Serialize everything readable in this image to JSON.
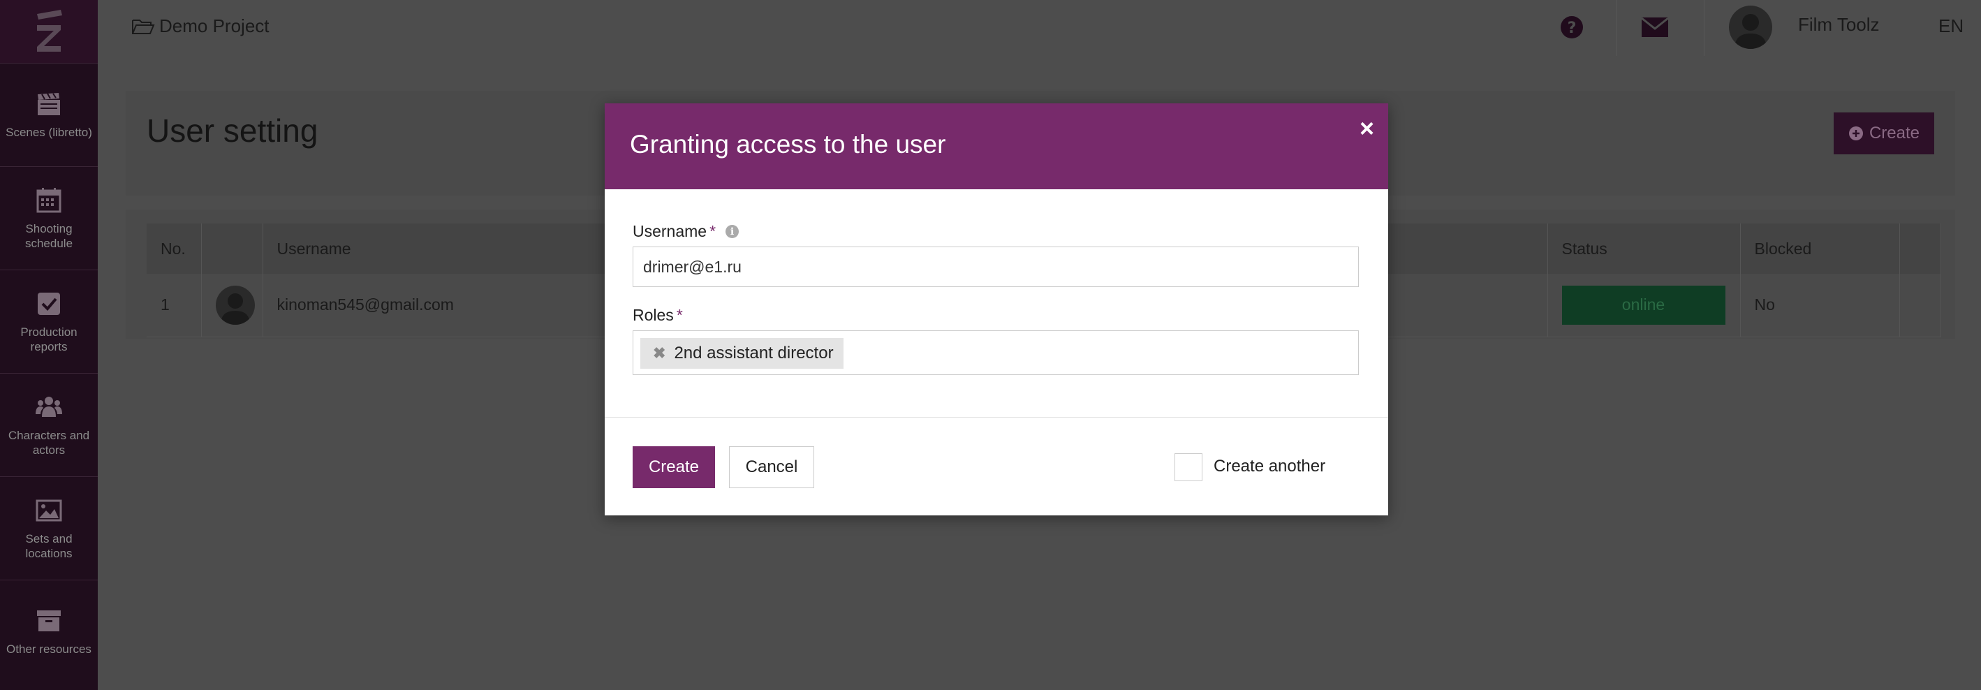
{
  "project": {
    "name": "Demo Project"
  },
  "sidebar": {
    "items": [
      {
        "label": "Scenes (libretto)",
        "icon": "clapperboard-icon"
      },
      {
        "label": "Shooting schedule",
        "icon": "calendar-icon"
      },
      {
        "label": "Production reports",
        "icon": "checkbox-icon"
      },
      {
        "label": "Characters and actors",
        "icon": "users-icon"
      },
      {
        "label": "Sets and locations",
        "icon": "image-icon"
      },
      {
        "label": "Other resources",
        "icon": "archive-icon"
      }
    ]
  },
  "topbar": {
    "user_name": "Film Toolz",
    "language": "EN"
  },
  "page": {
    "title": "User setting",
    "create_label": "Create"
  },
  "table": {
    "columns": [
      "No.",
      "",
      "Username",
      "Status",
      "Blocked"
    ],
    "rows": [
      {
        "no": "1",
        "username": "kinoman545@gmail.com",
        "status": "online",
        "blocked": "No"
      }
    ]
  },
  "modal": {
    "title": "Granting access to the user",
    "username_label": "Username",
    "username_value": "drimer@e1.ru",
    "required_mark": "*",
    "roles_label": "Roles",
    "role_tag": "2nd assistant director",
    "create_label": "Create",
    "cancel_label": "Cancel",
    "create_another_label": "Create another",
    "close_glyph": "×"
  },
  "colors": {
    "accent": "#772a6b",
    "status_online": "#0f3d24"
  }
}
